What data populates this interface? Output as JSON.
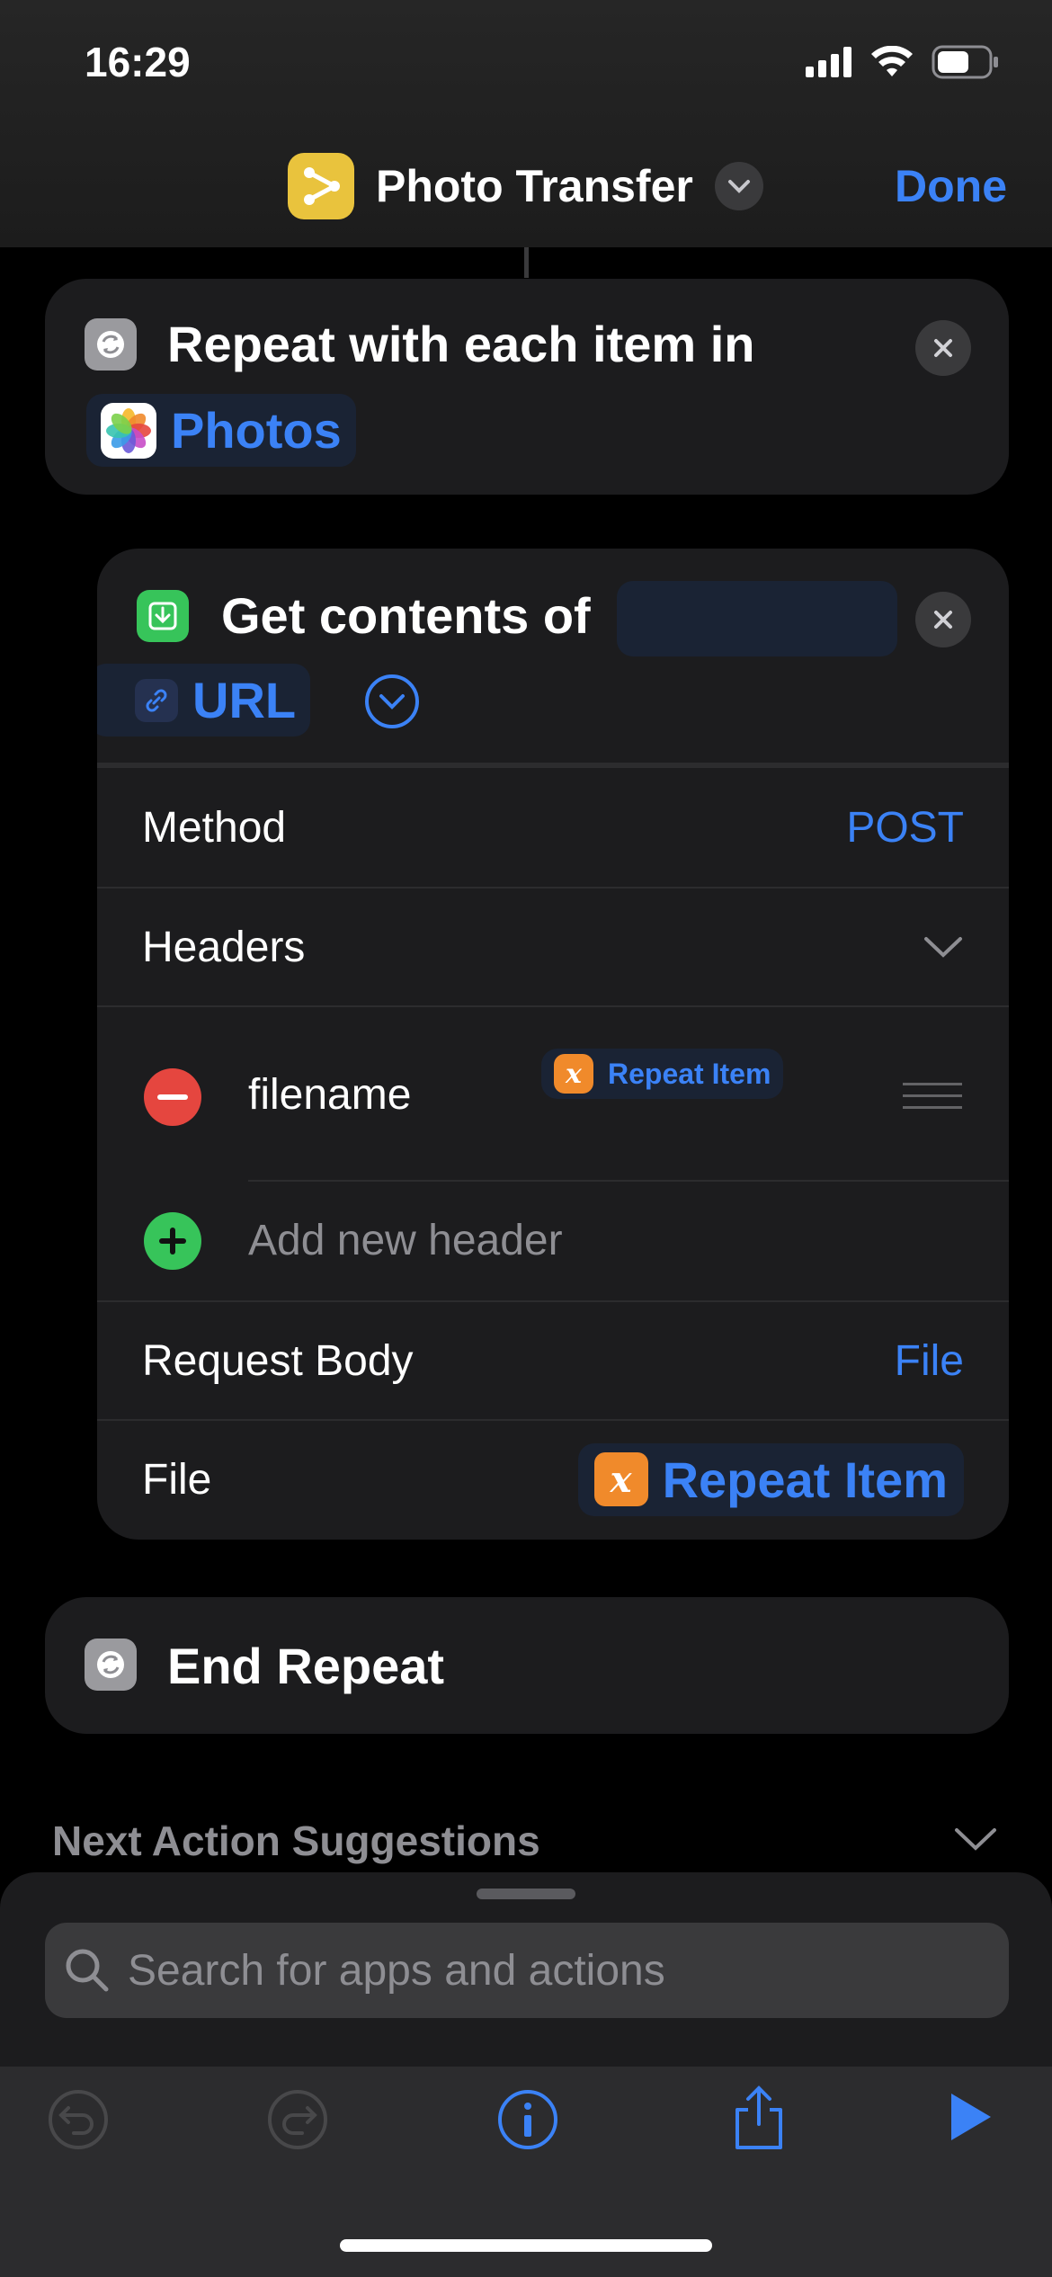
{
  "status_bar": {
    "time": "16:29"
  },
  "nav": {
    "title": "Photo Transfer",
    "done_label": "Done"
  },
  "repeat_action": {
    "text": "Repeat with each item in",
    "source_token": "Photos"
  },
  "get_contents": {
    "text": "Get contents of",
    "url_token": "URL",
    "rows": {
      "method_label": "Method",
      "method_value": "POST",
      "headers_label": "Headers",
      "header_key": "filename",
      "header_value_token": "Repeat Item",
      "add_header_placeholder": "Add new header",
      "body_label": "Request Body",
      "body_value": "File",
      "file_label": "File",
      "file_value_token": "Repeat Item"
    }
  },
  "end_repeat": {
    "text": "End Repeat"
  },
  "suggestions": {
    "title": "Next Action Suggestions"
  },
  "search": {
    "placeholder": "Search for apps and actions"
  },
  "colors": {
    "accent": "#3b82f6",
    "app_icon": "#e9c33d",
    "variable_token": "#f08a2b",
    "delete": "#e5463f",
    "add": "#37c45a"
  },
  "icons": {
    "app": "shortcuts-icon",
    "repeat": "repeat-icon",
    "download": "download-icon",
    "link": "link-icon",
    "photos": "photos-icon",
    "variable": "variable-x-icon",
    "search": "search-icon",
    "undo": "undo-icon",
    "redo": "redo-icon",
    "info": "info-icon",
    "share": "share-icon",
    "play": "play-icon"
  }
}
